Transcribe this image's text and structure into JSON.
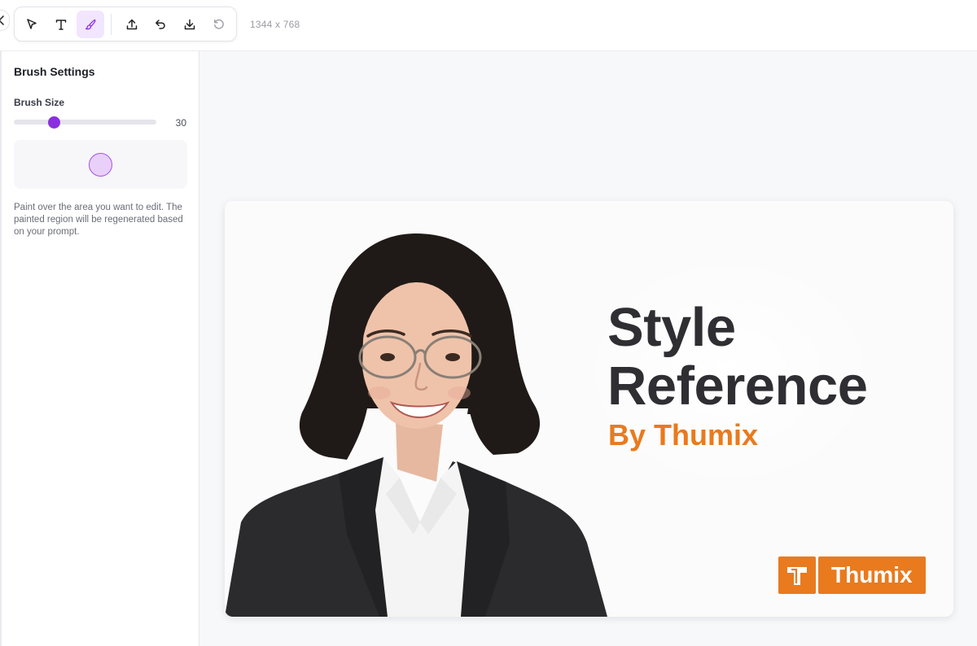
{
  "toolbar": {
    "tools": [
      {
        "name": "select-tool",
        "icon": "cursor-arrow-icon",
        "active": false
      },
      {
        "name": "text-tool",
        "icon": "text-t-icon",
        "active": false
      },
      {
        "name": "brush-tool",
        "icon": "brush-icon",
        "active": true
      },
      {
        "name": "upload-tool",
        "icon": "upload-icon",
        "active": false
      },
      {
        "name": "undo-tool",
        "icon": "undo-icon",
        "active": false
      },
      {
        "name": "download-tool",
        "icon": "download-icon",
        "active": false
      },
      {
        "name": "reset-tool",
        "icon": "rotate-ccw-icon",
        "active": false
      }
    ],
    "dimensions": "1344 x 768"
  },
  "sidebar": {
    "title": "Brush Settings",
    "brush_size_label": "Brush Size",
    "brush_size_value": "30",
    "brush_size_fraction": 0.28,
    "help_text": "Paint over the area you want to edit. The painted region will be regenerated based on your prompt."
  },
  "canvas": {
    "image": {
      "title_line1": "Style",
      "title_line2": "Reference",
      "subtitle": "By Thumix",
      "logo_text": "Thumix",
      "logo_mark": "T"
    }
  },
  "colors": {
    "accent": "#8b2ee0",
    "accent_light": "#f1e6fd",
    "brand_orange": "#ea7a1e",
    "title_text": "#2f2f33"
  }
}
